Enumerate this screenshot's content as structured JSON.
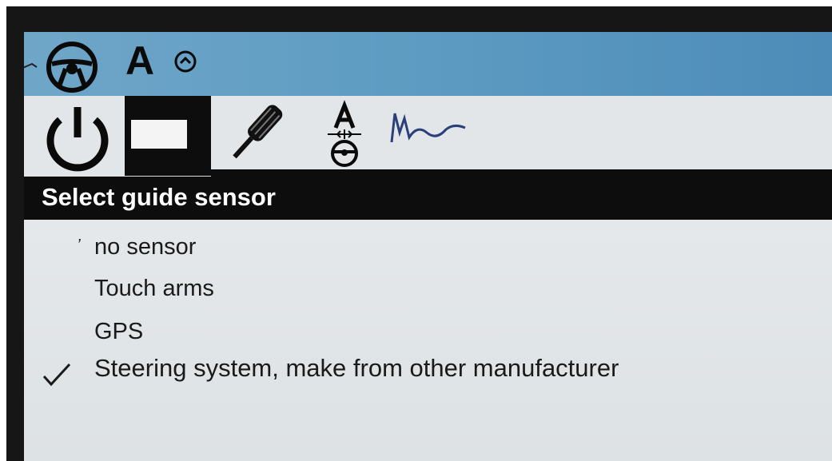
{
  "status_bar": {
    "steering_wheel_icon": "steering-wheel-icon",
    "mode_letter": "A",
    "small_indicator_icon": "circle-chevron-icon"
  },
  "tabs": [
    {
      "icon": "power-icon"
    },
    {
      "icon": "display-toggle-icon",
      "selected": true
    },
    {
      "icon": "screwdriver-icon"
    },
    {
      "icon": "calibrate-wheel-icon",
      "label": "A"
    },
    {
      "icon": "signal-wave-icon"
    }
  ],
  "menu": {
    "title": "Select guide sensor",
    "options": [
      {
        "label": "no sensor",
        "checked": false
      },
      {
        "label": "Touch arms",
        "checked": false
      },
      {
        "label": "GPS",
        "checked": false
      },
      {
        "label": "Steering system, make from other manufacturer",
        "checked": true
      }
    ]
  },
  "colors": {
    "status_bar": "#5d9bc2",
    "title_bar": "#0d0d0d",
    "screen_bg": "#e2e6e8"
  }
}
